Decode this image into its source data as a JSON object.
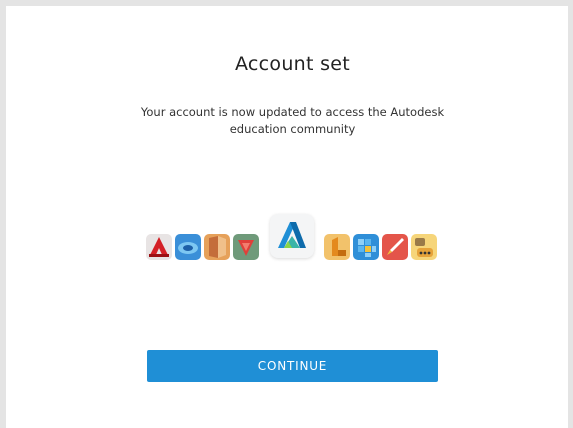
{
  "dialog": {
    "title": "Account set",
    "message": "Your account is now updated to access the Autodesk education community",
    "continue_label": "CONTINUE"
  },
  "icons": [
    "autocad-icon",
    "alias-icon",
    "revit-icon",
    "fusion-icon",
    "autodesk-logo-icon",
    "inventor-icon",
    "navisworks-icon",
    "sketchbook-icon",
    "more-apps-icon"
  ],
  "colors": {
    "button": "#1f8fd6",
    "border": "#e4e4e4"
  }
}
